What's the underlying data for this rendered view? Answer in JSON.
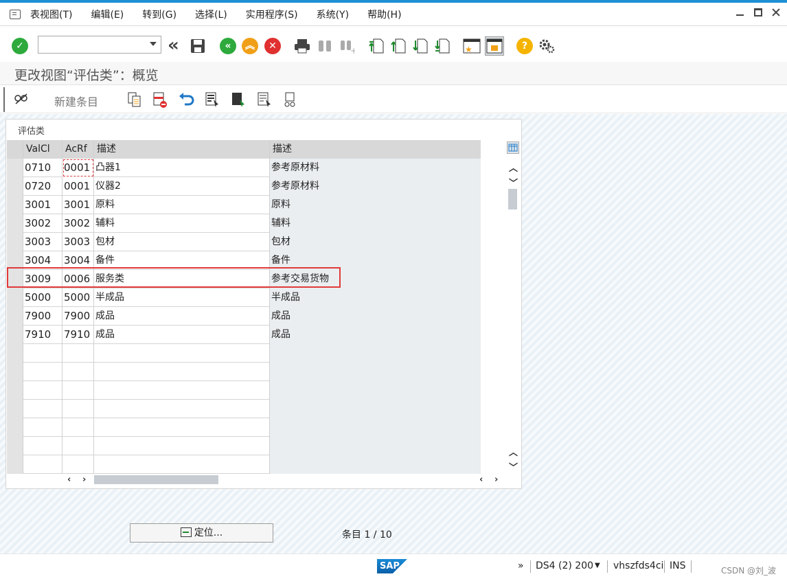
{
  "menubar": {
    "items": [
      "表视图(T)",
      "编辑(E)",
      "转到(G)",
      "选择(L)",
      "实用程序(S)",
      "系统(Y)",
      "帮助(H)"
    ]
  },
  "command_field": {
    "value": ""
  },
  "title": "更改视图“评估类”：概览",
  "toolbar2": {
    "new_entries": "新建条目"
  },
  "panel": {
    "title": "评估类"
  },
  "table": {
    "headers": [
      "ValCl",
      "AcRf",
      "描述",
      "描述"
    ],
    "rows": [
      [
        "0710",
        "0001",
        "凸器1",
        "参考原材料"
      ],
      [
        "0720",
        "0001",
        "仪器2",
        "参考原材料"
      ],
      [
        "3001",
        "3001",
        "原料",
        "原料"
      ],
      [
        "3002",
        "3002",
        "辅料",
        "辅料"
      ],
      [
        "3003",
        "3003",
        "包材",
        "包材"
      ],
      [
        "3004",
        "3004",
        "备件",
        "备件"
      ],
      [
        "3009",
        "0006",
        "服务类",
        "参考交易货物"
      ],
      [
        "5000",
        "5000",
        "半成品",
        "半成品"
      ],
      [
        "7900",
        "7900",
        "成品",
        "成品"
      ],
      [
        "7910",
        "7910",
        "成品",
        "成品"
      ]
    ],
    "empty_rows": 7
  },
  "footer": {
    "locate_button": "定位...",
    "entry_count": "条目 1 / 10"
  },
  "statusbar": {
    "logo": "SAP",
    "expand": "»",
    "system": "DS4 (2) 200",
    "server": "vhszfds4ci",
    "mode": "INS",
    "watermark": "CSDN @刘_波"
  },
  "colors": {
    "accent": "#1e90d4",
    "highlight_border": "#e0393a",
    "ok_green": "#2eaa3c",
    "cancel_red": "#e03030",
    "exit_orange": "#f0a018"
  }
}
